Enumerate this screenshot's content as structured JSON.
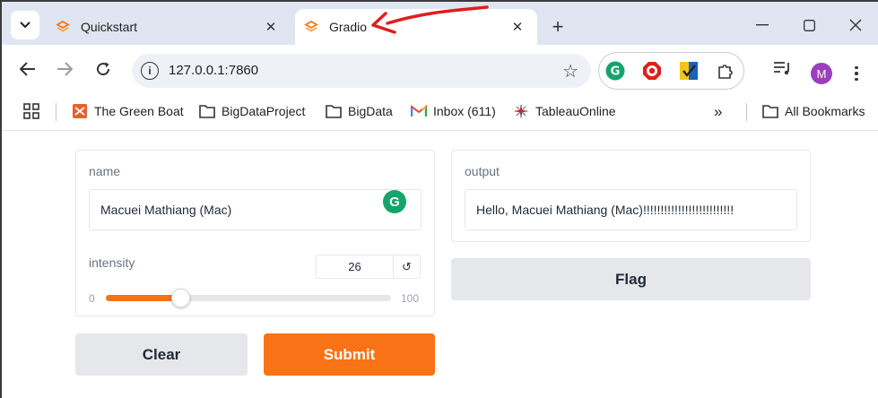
{
  "colors": {
    "accent": "#f97316",
    "annotation": "#e11d1d",
    "avatar": "#9b3fbf"
  },
  "browser": {
    "tabs": [
      {
        "title": "Quickstart",
        "icon": "gradio-logo-icon",
        "active": false
      },
      {
        "title": "Gradio",
        "icon": "gradio-logo-icon",
        "active": true
      }
    ],
    "address": {
      "url": "127.0.0.1:7860"
    },
    "profile_initial": "M",
    "bookmarks": [
      {
        "label": "The Green Boat",
        "icon": "green-boat-icon"
      },
      {
        "label": "BigDataProject",
        "icon": "folder-icon"
      },
      {
        "label": "BigData",
        "icon": "folder-icon"
      },
      {
        "label": "Inbox (611)",
        "icon": "gmail-icon"
      },
      {
        "label": "TableauOnline",
        "icon": "tableau-icon"
      }
    ],
    "all_bookmarks": "All Bookmarks",
    "more_bookmarks": "»"
  },
  "app": {
    "name_field": {
      "label": "name",
      "value": "Macuei Mathiang (Mac)"
    },
    "intensity": {
      "label": "intensity",
      "value": "26",
      "min": "0",
      "max": "100",
      "level": 26
    },
    "output_field": {
      "label": "output",
      "value": "Hello, Macuei Mathiang (Mac)!!!!!!!!!!!!!!!!!!!!!!!!!!"
    },
    "clear_label": "Clear",
    "submit_label": "Submit",
    "flag_label": "Flag"
  }
}
